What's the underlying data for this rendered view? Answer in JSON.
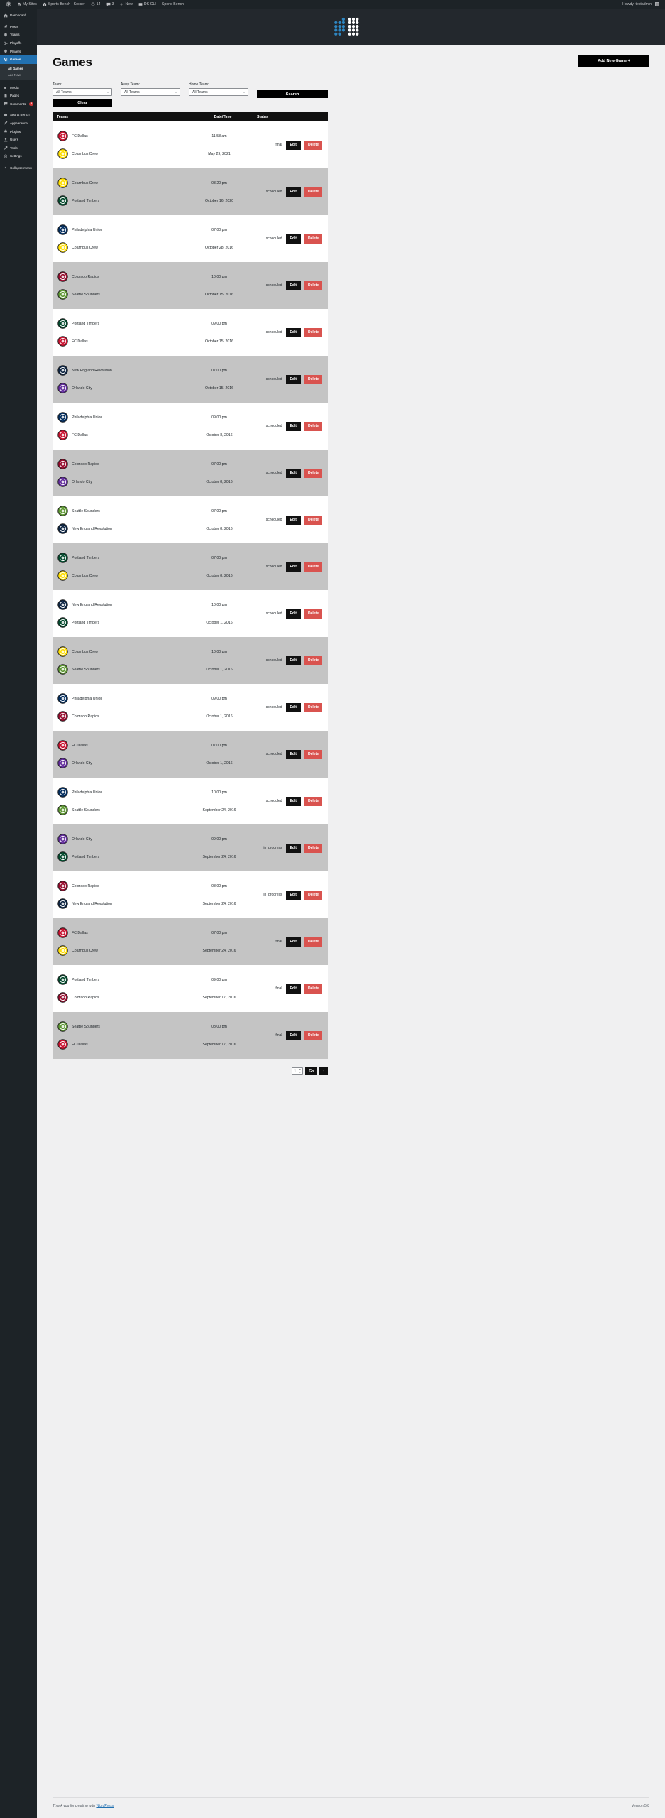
{
  "adminbar": {
    "left_items": [
      {
        "icon": "wordpress-logo-icon",
        "label": ""
      },
      {
        "icon": "my-sites-icon",
        "label": "My Sites"
      },
      {
        "icon": "site-icon",
        "label": "Sports Bench - Soccer"
      },
      {
        "icon": "updates-icon",
        "label": "14"
      },
      {
        "icon": "comments-icon",
        "label": "3"
      },
      {
        "icon": "plus-icon",
        "label": "New"
      },
      {
        "icon": "ds-cli-icon",
        "label": "DS-CLI"
      },
      {
        "icon": "",
        "label": "Sports Bench"
      }
    ],
    "howdy": "Howdy, testadmin"
  },
  "sidebar": {
    "items": [
      {
        "label": "Dashboard",
        "icon": "dashboard-icon",
        "current": false,
        "sep": true
      },
      {
        "label": "Posts",
        "icon": "posts-pin-icon",
        "current": false,
        "sep": true
      },
      {
        "label": "Teams",
        "icon": "teams-icon",
        "current": false,
        "sep": false
      },
      {
        "label": "Playoffs",
        "icon": "playoffs-bracket-icon",
        "current": false,
        "sep": false
      },
      {
        "label": "Players",
        "icon": "players-icon",
        "current": false,
        "sep": false
      },
      {
        "label": "Games",
        "icon": "games-icon",
        "current": true,
        "sep": false
      },
      {
        "label": "Media",
        "icon": "media-icon",
        "current": false,
        "sep": true
      },
      {
        "label": "Pages",
        "icon": "pages-icon",
        "current": false,
        "sep": false
      },
      {
        "label": "Comments",
        "icon": "comments-icon",
        "current": false,
        "sep": false,
        "bubble": "3"
      },
      {
        "label": "Sports Bench",
        "icon": "sports-bench-icon",
        "current": false,
        "sep": true
      },
      {
        "label": "Appearance",
        "icon": "appearance-brush-icon",
        "current": false,
        "sep": false
      },
      {
        "label": "Plugins",
        "icon": "plugins-icon",
        "current": false,
        "sep": false
      },
      {
        "label": "Users",
        "icon": "users-icon",
        "current": false,
        "sep": false
      },
      {
        "label": "Tools",
        "icon": "tools-icon",
        "current": false,
        "sep": false
      },
      {
        "label": "Settings",
        "icon": "settings-gear-icon",
        "current": false,
        "sep": false
      }
    ],
    "submenu": [
      {
        "label": "All Games",
        "active": true
      },
      {
        "label": "Add New",
        "active": false
      }
    ],
    "collapse_label": "Collapse menu",
    "collapse_icon": "collapse-arrow-icon"
  },
  "page": {
    "title": "Games",
    "add_button": "Add New Game +"
  },
  "filters": {
    "team": {
      "label": "Team:",
      "value": "All Teams"
    },
    "away_team": {
      "label": "Away Team:",
      "value": "All Teams"
    },
    "home_team": {
      "label": "Home Team:",
      "value": "All Teams"
    },
    "clear_label": "Clear",
    "search_label": "Search"
  },
  "table": {
    "columns": [
      "Teams",
      "Date/Time",
      "Status"
    ],
    "edit_label": "Edit",
    "delete_label": "Delete",
    "rows": [
      {
        "away": "FC Dallas",
        "home": "Columbus Crew",
        "time": "11:58 am",
        "date": "May 29, 2021",
        "status": "final",
        "away_crest": "fc-dallas-crest-icon",
        "home_crest": "columbus-crew-crest-icon",
        "away_color": "#c8102e",
        "home_color": "#fedd00",
        "alt": false
      },
      {
        "away": "Columbus Crew",
        "home": "Portland Timbers",
        "time": "03:20 pm",
        "date": "October 16, 2020",
        "status": "scheduled",
        "away_crest": "columbus-crew-crest-icon",
        "home_crest": "portland-timbers-crest-icon",
        "away_color": "#fedd00",
        "home_color": "#00482b",
        "alt": true
      },
      {
        "away": "Philadelphia Union",
        "home": "Columbus Crew",
        "time": "07:00 pm",
        "date": "October 28, 2016",
        "status": "scheduled",
        "away_crest": "philadelphia-union-crest-icon",
        "home_crest": "columbus-crew-crest-icon",
        "away_color": "#002b5c",
        "home_color": "#fedd00",
        "alt": false
      },
      {
        "away": "Colorado Rapids",
        "home": "Seattle Sounders",
        "time": "10:00 pm",
        "date": "October 15, 2016",
        "status": "scheduled",
        "away_crest": "colorado-rapids-crest-icon",
        "home_crest": "seattle-sounders-crest-icon",
        "away_color": "#960a2c",
        "home_color": "#5d9732",
        "alt": true
      },
      {
        "away": "Portland Timbers",
        "home": "FC Dallas",
        "time": "09:00 pm",
        "date": "October 15, 2016",
        "status": "scheduled",
        "away_crest": "portland-timbers-crest-icon",
        "home_crest": "fc-dallas-crest-icon",
        "away_color": "#00482b",
        "home_color": "#c8102e",
        "alt": false
      },
      {
        "away": "New England Revolution",
        "home": "Orlando City",
        "time": "07:00 pm",
        "date": "October 15, 2016",
        "status": "scheduled",
        "away_crest": "new-england-revolution-crest-icon",
        "home_crest": "orlando-city-crest-icon",
        "away_color": "#0a2240",
        "home_color": "#612b9b",
        "alt": true
      },
      {
        "away": "Philadelphia Union",
        "home": "FC Dallas",
        "time": "09:00 pm",
        "date": "October 8, 2016",
        "status": "scheduled",
        "away_crest": "philadelphia-union-crest-icon",
        "home_crest": "fc-dallas-crest-icon",
        "away_color": "#002b5c",
        "home_color": "#c8102e",
        "alt": false
      },
      {
        "away": "Colorado Rapids",
        "home": "Orlando City",
        "time": "07:00 pm",
        "date": "October 8, 2016",
        "status": "scheduled",
        "away_crest": "colorado-rapids-crest-icon",
        "home_crest": "orlando-city-crest-icon",
        "away_color": "#960a2c",
        "home_color": "#612b9b",
        "alt": true
      },
      {
        "away": "Seattle Sounders",
        "home": "New England Revolution",
        "time": "07:00 pm",
        "date": "October 8, 2016",
        "status": "scheduled",
        "away_crest": "seattle-sounders-crest-icon",
        "home_crest": "new-england-revolution-crest-icon",
        "away_color": "#5d9732",
        "home_color": "#0a2240",
        "alt": false
      },
      {
        "away": "Portland Timbers",
        "home": "Columbus Crew",
        "time": "07:00 pm",
        "date": "October 8, 2016",
        "status": "scheduled",
        "away_crest": "portland-timbers-crest-icon",
        "home_crest": "columbus-crew-crest-icon",
        "away_color": "#00482b",
        "home_color": "#fedd00",
        "alt": true
      },
      {
        "away": "New England Revolution",
        "home": "Portland Timbers",
        "time": "10:00 pm",
        "date": "October 1, 2016",
        "status": "scheduled",
        "away_crest": "new-england-revolution-crest-icon",
        "home_crest": "portland-timbers-crest-icon",
        "away_color": "#0a2240",
        "home_color": "#00482b",
        "alt": false
      },
      {
        "away": "Columbus Crew",
        "home": "Seattle Sounders",
        "time": "10:00 pm",
        "date": "October 1, 2016",
        "status": "scheduled",
        "away_crest": "columbus-crew-crest-icon",
        "home_crest": "seattle-sounders-crest-icon",
        "away_color": "#fedd00",
        "home_color": "#5d9732",
        "alt": true
      },
      {
        "away": "Philadelphia Union",
        "home": "Colorado Rapids",
        "time": "09:00 pm",
        "date": "October 1, 2016",
        "status": "scheduled",
        "away_crest": "philadelphia-union-crest-icon",
        "home_crest": "colorado-rapids-crest-icon",
        "away_color": "#002b5c",
        "home_color": "#960a2c",
        "alt": false
      },
      {
        "away": "FC Dallas",
        "home": "Orlando City",
        "time": "07:00 pm",
        "date": "October 1, 2016",
        "status": "scheduled",
        "away_crest": "fc-dallas-crest-icon",
        "home_crest": "orlando-city-crest-icon",
        "away_color": "#c8102e",
        "home_color": "#612b9b",
        "alt": true
      },
      {
        "away": "Philadelphia Union",
        "home": "Seattle Sounders",
        "time": "10:00 pm",
        "date": "September 24, 2016",
        "status": "scheduled",
        "away_crest": "philadelphia-union-crest-icon",
        "home_crest": "seattle-sounders-crest-icon",
        "away_color": "#002b5c",
        "home_color": "#5d9732",
        "alt": false
      },
      {
        "away": "Orlando City",
        "home": "Portland Timbers",
        "time": "09:00 pm",
        "date": "September 24, 2016",
        "status": "in_progress",
        "away_crest": "orlando-city-crest-icon",
        "home_crest": "portland-timbers-crest-icon",
        "away_color": "#612b9b",
        "home_color": "#00482b",
        "alt": true
      },
      {
        "away": "Colorado Rapids",
        "home": "New England Revolution",
        "time": "08:00 pm",
        "date": "September 24, 2016",
        "status": "in_progress",
        "away_crest": "colorado-rapids-crest-icon",
        "home_crest": "new-england-revolution-crest-icon",
        "away_color": "#960a2c",
        "home_color": "#0a2240",
        "alt": false
      },
      {
        "away": "FC Dallas",
        "home": "Columbus Crew",
        "time": "07:00 pm",
        "date": "September 24, 2016",
        "status": "final",
        "away_crest": "fc-dallas-crest-icon",
        "home_crest": "columbus-crew-crest-icon",
        "away_color": "#c8102e",
        "home_color": "#fedd00",
        "alt": true
      },
      {
        "away": "Portland Timbers",
        "home": "Colorado Rapids",
        "time": "09:00 pm",
        "date": "September 17, 2016",
        "status": "final",
        "away_crest": "portland-timbers-crest-icon",
        "home_crest": "colorado-rapids-crest-icon",
        "away_color": "#00482b",
        "home_color": "#960a2c",
        "alt": false
      },
      {
        "away": "Seattle Sounders",
        "home": "FC Dallas",
        "time": "08:00 pm",
        "date": "September 17, 2016",
        "status": "final",
        "away_crest": "seattle-sounders-crest-icon",
        "home_crest": "fc-dallas-crest-icon",
        "away_color": "#5d9732",
        "home_color": "#c8102e",
        "alt": true
      }
    ]
  },
  "pagination": {
    "page_value": "1",
    "go_label": "Go",
    "next_label": "›"
  },
  "footer": {
    "thanks_prefix": "Thank you for creating with ",
    "link": "WordPress",
    "suffix": ".",
    "version": "Version 5.8"
  }
}
